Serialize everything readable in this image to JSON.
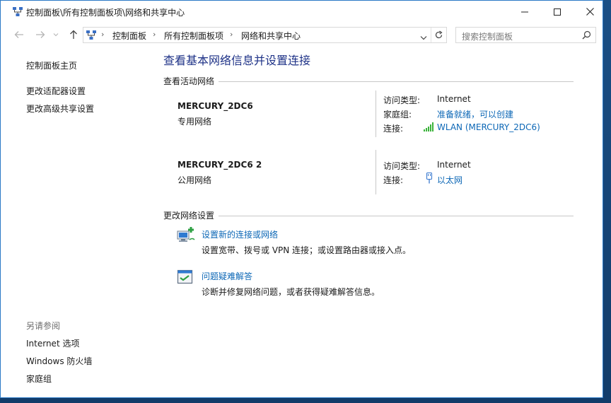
{
  "window": {
    "title": "控制面板\\所有控制面板项\\网络和共享中心"
  },
  "address": {
    "crumbs": [
      "控制面板",
      "所有控制面板项",
      "网络和共享中心"
    ]
  },
  "search": {
    "placeholder": "搜索控制面板"
  },
  "sidebar": {
    "home": "控制面板主页",
    "items": [
      "更改适配器设置",
      "更改高级共享设置"
    ],
    "see_also_title": "另请参阅",
    "see_also": [
      "Internet 选项",
      "Windows 防火墙",
      "家庭组"
    ]
  },
  "main": {
    "title": "查看基本网络信息并设置连接",
    "active_networks_label": "查看活动网络",
    "networks": [
      {
        "name": "MERCURY_2DC6",
        "type": "专用网络",
        "access_key": "访问类型:",
        "access_val": "Internet",
        "homegroup_key": "家庭组:",
        "homegroup_val": "准备就绪，可以创建",
        "conn_key": "连接:",
        "conn_val": "WLAN (MERCURY_2DC6)"
      },
      {
        "name": "MERCURY_2DC6  2",
        "type": "公用网络",
        "access_key": "访问类型:",
        "access_val": "Internet",
        "conn_key": "连接:",
        "conn_val": "以太网"
      }
    ],
    "change_settings_label": "更改网络设置",
    "tasks": [
      {
        "title": "设置新的连接或网络",
        "desc": "设置宽带、拨号或 VPN 连接；或设置路由器或接入点。",
        "icon": "new-connection-icon"
      },
      {
        "title": "问题疑难解答",
        "desc": "诊断并修复网络问题，或者获得疑难解答信息。",
        "icon": "troubleshoot-icon"
      }
    ]
  },
  "colors": {
    "link": "#0c67b6",
    "title": "#1e3287",
    "wifi_bars": "#3bb33b",
    "desktop": "#1a4f86"
  }
}
